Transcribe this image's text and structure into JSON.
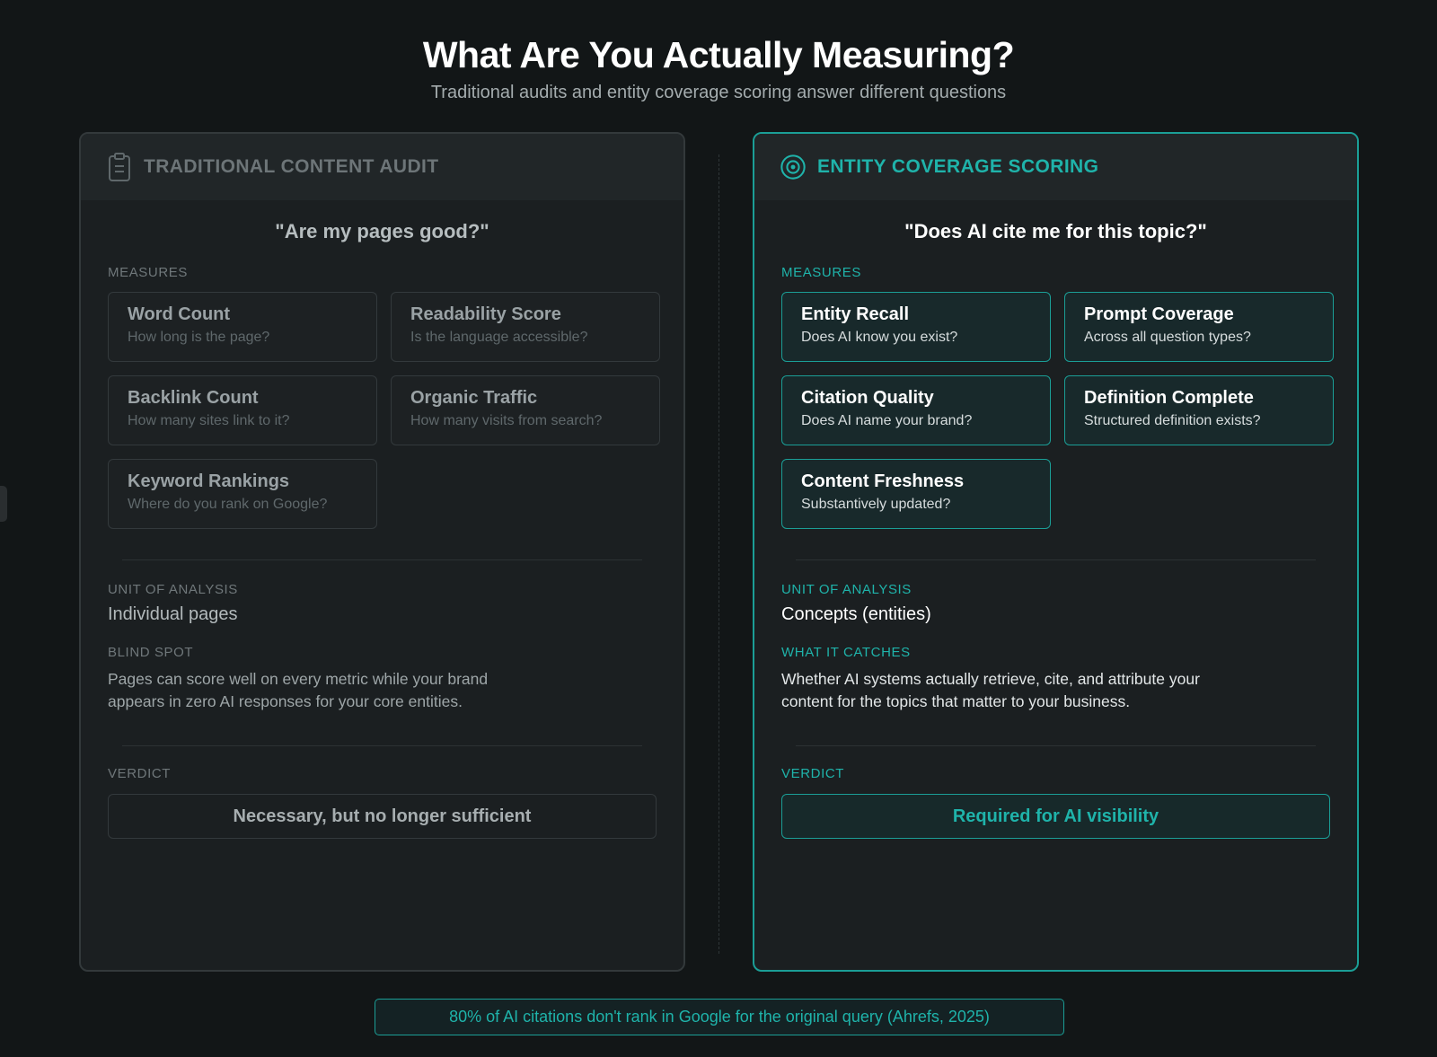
{
  "header": {
    "title": "What Are You Actually Measuring?",
    "subtitle": "Traditional audits and entity coverage scoring answer different questions"
  },
  "left_panel": {
    "icon": "clipboard-icon",
    "title": "TRADITIONAL CONTENT AUDIT",
    "question": "\"Are my pages good?\"",
    "measures_label": "MEASURES",
    "measures": [
      {
        "title": "Word Count",
        "subtitle": "How long is the page?"
      },
      {
        "title": "Readability Score",
        "subtitle": "Is the language accessible?"
      },
      {
        "title": "Backlink Count",
        "subtitle": "How many sites link to it?"
      },
      {
        "title": "Organic Traffic",
        "subtitle": "How many visits from search?"
      },
      {
        "title": "Keyword Rankings",
        "subtitle": "Where do you rank on Google?"
      }
    ],
    "unit_label": "UNIT OF ANALYSIS",
    "unit_value": "Individual pages",
    "insight_label": "BLIND SPOT",
    "insight_text": "Pages can score well on every metric while your brand appears in zero AI responses for your core entities.",
    "verdict_label": "VERDICT",
    "verdict": "Necessary, but no longer sufficient"
  },
  "right_panel": {
    "icon": "target-icon",
    "title": "ENTITY COVERAGE SCORING",
    "question": "\"Does AI cite me for this topic?\"",
    "measures_label": "MEASURES",
    "measures": [
      {
        "title": "Entity Recall",
        "subtitle": "Does AI know you exist?"
      },
      {
        "title": "Prompt Coverage",
        "subtitle": "Across all question types?"
      },
      {
        "title": "Citation Quality",
        "subtitle": "Does AI name your brand?"
      },
      {
        "title": "Definition Complete",
        "subtitle": "Structured definition exists?"
      },
      {
        "title": "Content Freshness",
        "subtitle": "Substantively updated?"
      }
    ],
    "unit_label": "UNIT OF ANALYSIS",
    "unit_value": "Concepts (entities)",
    "insight_label": "WHAT IT CATCHES",
    "insight_text": "Whether AI systems actually retrieve, cite, and attribute your content for the topics that matter to your business.",
    "verdict_label": "VERDICT",
    "verdict": "Required for AI visibility"
  },
  "footer": {
    "note": "80% of AI citations don't rank in Google for the original query (Ahrefs, 2025)"
  },
  "colors": {
    "background": "#121617",
    "panel": "#1b1f21",
    "accent": "#1fb3aa",
    "muted": "#6d7578"
  }
}
